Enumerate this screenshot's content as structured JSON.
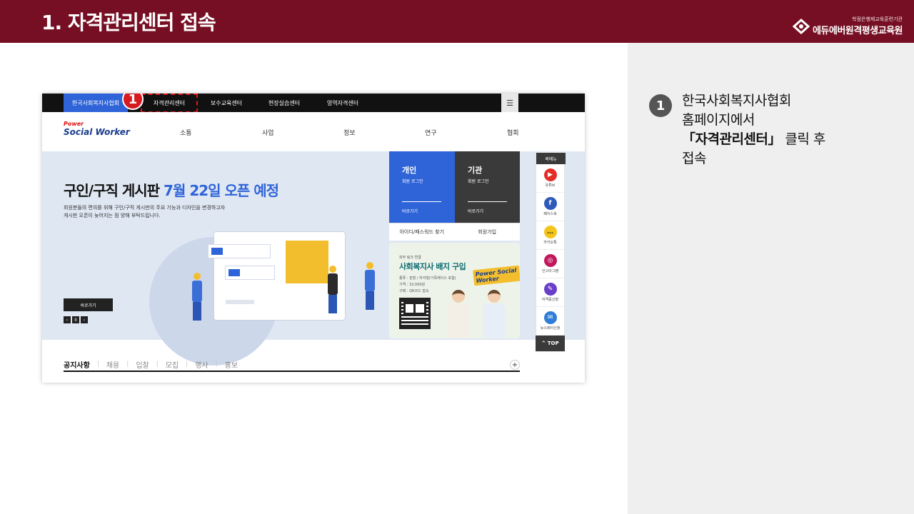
{
  "slide": {
    "title": "1. 자격관리센터 접속",
    "brand_sub": "학점은행제교육훈련기관",
    "brand_main": "에듀에버원격평생교육원"
  },
  "instruction": {
    "step_number": "1",
    "line1": "한국사회복지사협회",
    "line2": "홈페이지에서",
    "line3_bold": "「자격관리센터」",
    "line3_rest": " 클릭 후",
    "line4": "접속"
  },
  "site": {
    "gnb_tabs": [
      "한국사회복지사협회",
      "자격관리센터",
      "보수교육센터",
      "현장실습센터",
      "영역자격센터"
    ],
    "menu_icon": "☰",
    "callout_number": "1",
    "logo_power": "Power",
    "logo_name": "Social Worker",
    "nav": [
      "소통",
      "사업",
      "정보",
      "연구",
      "협회"
    ],
    "hero": {
      "title_black": "구인/구직 게시판",
      "title_blue": "7월 22일 오픈 예정",
      "desc_line1": "회원분들의 편의를 위해 구인/구직 게시판의 주요 기능과 디자인을 변경하고자",
      "desc_line2": "게시판 오픈이 늦어지는 점 양해 부탁드립니다.",
      "button": "바로가기",
      "controls": [
        "‹",
        "II",
        "›"
      ]
    },
    "login": {
      "personal_title": "개인",
      "personal_sub": "회원 로그인",
      "personal_go": "바로가기",
      "org_title": "기관",
      "org_sub": "회원 로그인",
      "org_go": "바로가기",
      "find": "아이디/패스워드 찾기",
      "join": "회원가입"
    },
    "badge": {
      "kicker": "외부 링크 연결",
      "title": "사회복지사 배지 구입",
      "info1": "종류 : 핀형 / 자석형(가족케이스 포함)",
      "info2": "가격 : 10,000원",
      "info3": "구매 : QR코드 접속",
      "logo_text": "Power Social Worker"
    },
    "quick": {
      "header": "퀵메뉴",
      "items": [
        {
          "label": "유튜브",
          "icon": "youtube-icon",
          "color": "#e52d27",
          "glyph": "▶"
        },
        {
          "label": "페이스북",
          "icon": "facebook-icon",
          "color": "#2d5bb9",
          "glyph": "f"
        },
        {
          "label": "카카오톡",
          "icon": "kakaotalk-icon",
          "color": "#f3c51a",
          "glyph": "…"
        },
        {
          "label": "인스타그램",
          "icon": "instagram-icon",
          "color": "#c2185b",
          "glyph": "◎"
        },
        {
          "label": "자격증신청",
          "icon": "certificate-icon",
          "color": "#6a3fc8",
          "glyph": "✎"
        },
        {
          "label": "뉴스레터신청",
          "icon": "newsletter-icon",
          "color": "#2f7dd8",
          "glyph": "✉"
        }
      ],
      "top": "TOP"
    },
    "notice_tabs": [
      "공지사항",
      "채용",
      "입찰",
      "모집",
      "행사",
      "홍보"
    ],
    "notice_plus": "+"
  },
  "colors": {
    "header_bar": "#760f23",
    "accent_blue": "#2f64d8",
    "callout_red": "#d71920"
  }
}
